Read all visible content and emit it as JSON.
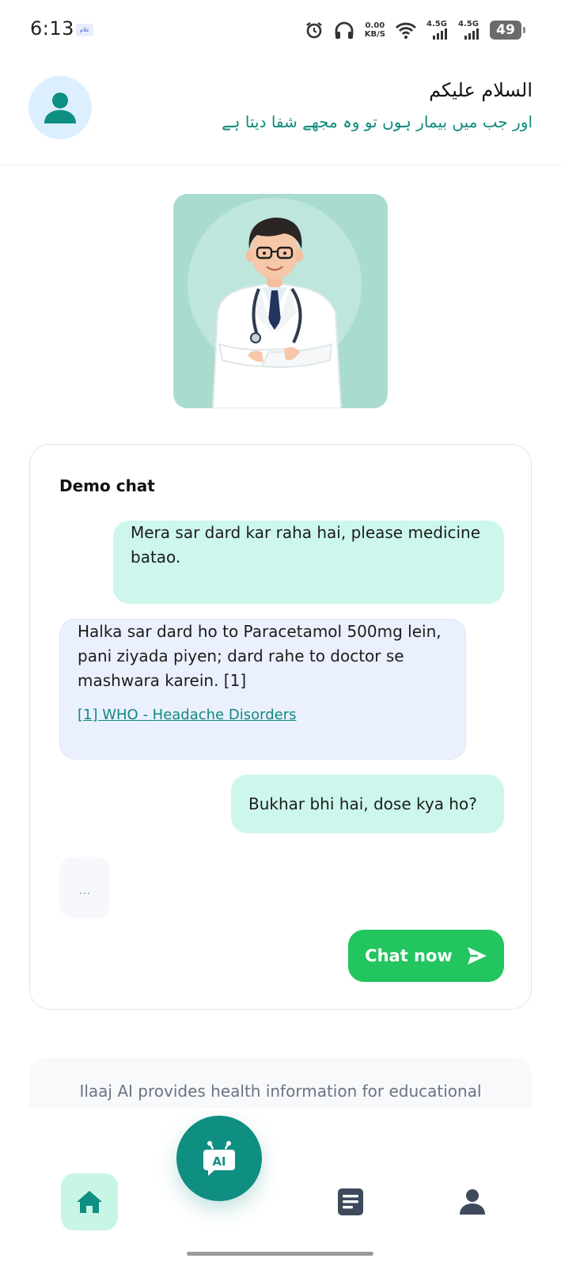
{
  "status_bar": {
    "time": "6:13",
    "notification_badge": "علام",
    "speed_value": "0.00",
    "speed_unit": "KB/S",
    "network_1": "4.5G",
    "network_2": "4.5G",
    "battery": "49"
  },
  "header": {
    "greeting": "السلام علیکم",
    "verse": "اور جب میں بیمار ہوں تو وہ مجھے شفا دیتا ہے",
    "icons": {
      "avatar": "user-icon"
    }
  },
  "demo_chat": {
    "title": "Demo chat",
    "messages": [
      {
        "role": "user",
        "text": "Mera sar dard kar raha hai, please medicine batao."
      },
      {
        "role": "ai",
        "text": "Halka sar dard ho to Paracetamol 500mg lein, pani ziyada piyen; dard rahe to doctor se mashwara karein. [1]",
        "reference": "[1] WHO - Headache Disorders"
      },
      {
        "role": "user",
        "text": "Bukhar bhi hai, dose kya ho?"
      }
    ],
    "typing_indicator": "...",
    "cta_label": "Chat now",
    "cta_icon": "send-icon"
  },
  "disclaimer": {
    "text": "Ilaaj AI provides health information for educational"
  },
  "bottom_nav": {
    "ai_button_label": "AI",
    "items": [
      {
        "name": "home",
        "icon": "home-icon",
        "active": true
      },
      {
        "name": "records",
        "icon": "document-icon",
        "active": false
      },
      {
        "name": "profile",
        "icon": "user-icon",
        "active": false
      }
    ]
  },
  "colors": {
    "brand_teal": "#0f8f82",
    "accent_green": "#22c55e",
    "user_bubble": "#cdf7ec",
    "ai_bubble": "#eaf0fd",
    "hero_bg": "#a9dccf"
  }
}
